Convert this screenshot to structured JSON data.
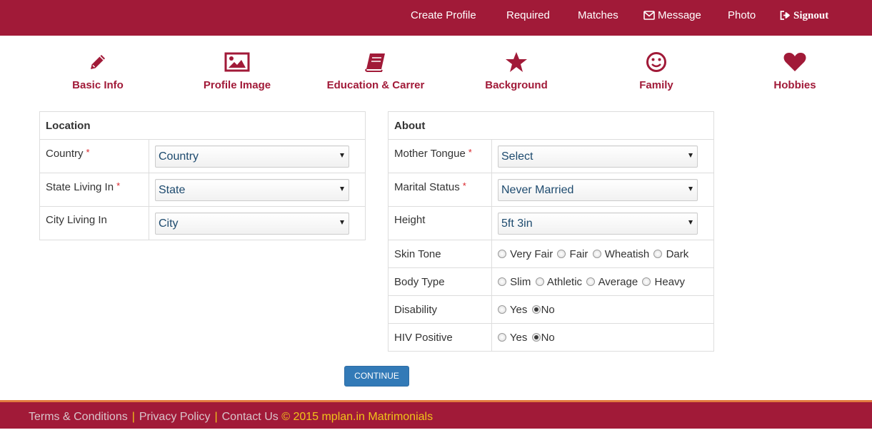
{
  "nav": {
    "create_profile": "Create Profile",
    "required": "Required",
    "matches": "Matches",
    "message": "Message",
    "photo": "Photo",
    "signout": "Signout"
  },
  "steps": [
    {
      "label": "Basic Info",
      "icon": "pencil-icon"
    },
    {
      "label": "Profile Image",
      "icon": "image-icon"
    },
    {
      "label": "Education & Carrer",
      "icon": "book-icon"
    },
    {
      "label": "Background",
      "icon": "star-icon"
    },
    {
      "label": "Family",
      "icon": "smile-icon"
    },
    {
      "label": "Hobbies",
      "icon": "heart-icon"
    }
  ],
  "location": {
    "header": "Location",
    "country_label": "Country",
    "country_value": "Country",
    "state_label": "State Living In",
    "state_value": "State",
    "city_label": "City Living In",
    "city_value": "City"
  },
  "about": {
    "header": "About",
    "mother_tongue_label": "Mother Tongue",
    "mother_tongue_value": "Select",
    "marital_label": "Marital Status",
    "marital_value": "Never Married",
    "height_label": "Height",
    "height_value": "5ft 3in",
    "skin_label": "Skin Tone",
    "skin_options": [
      "Very Fair",
      "Fair",
      "Wheatish",
      "Dark"
    ],
    "body_label": "Body Type",
    "body_options": [
      "Slim",
      "Athletic",
      "Average",
      "Heavy"
    ],
    "disability_label": "Disability",
    "disability_options": [
      "Yes",
      "No"
    ],
    "disability_selected": "No",
    "hiv_label": "HIV Positive",
    "hiv_options": [
      "Yes",
      "No"
    ],
    "hiv_selected": "No"
  },
  "required_mark": "*",
  "continue_label": "CONTINUE",
  "footer": {
    "terms": "Terms & Conditions",
    "privacy": "Privacy Policy",
    "contact": "Contact Us",
    "separator": "|",
    "copyright": "© 2015 mplan.in Matrimonials"
  },
  "colors": {
    "brand": "#a11a38",
    "button": "#337ab7",
    "footer_accent": "#f0c419"
  }
}
